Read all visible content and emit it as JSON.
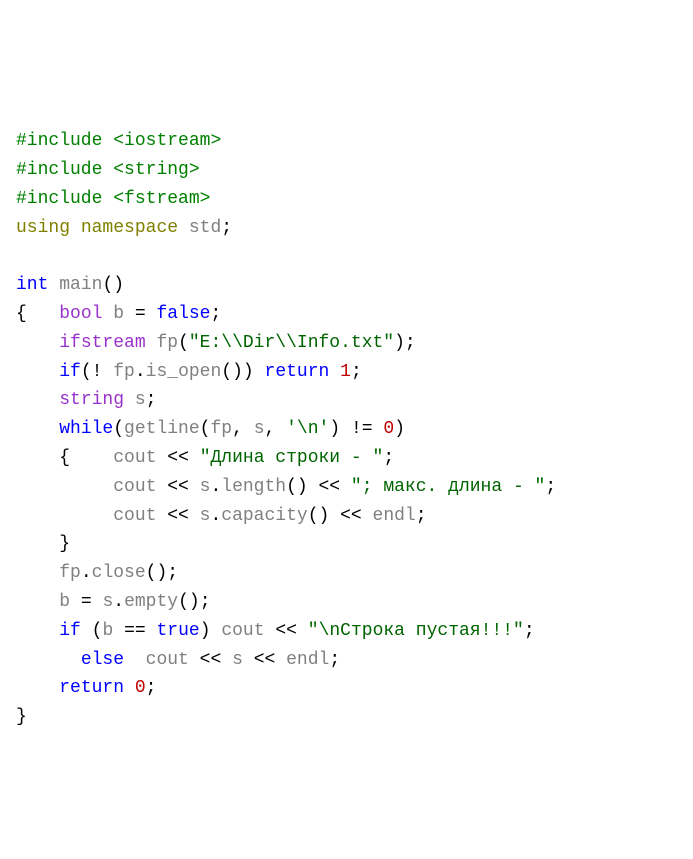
{
  "code": {
    "include1_kw": "#include",
    "include1_hdr": "<iostream>",
    "include2_kw": "#include",
    "include2_hdr": "<string>",
    "include3_kw": "#include",
    "include3_hdr": "<fstream>",
    "using_kw": "using",
    "namespace_kw": "namespace",
    "std_id": "std",
    "semi": ";",
    "int_kw": "int",
    "main_id": "main",
    "parens_empty": "()",
    "lbrace": "{",
    "rbrace": "}",
    "bool_kw": "bool",
    "b_id": "b",
    "eq": " = ",
    "false_kw": "false",
    "ifstream_kw": "ifstream",
    "fp_id": "fp",
    "lparen": "(",
    "rparen": ")",
    "path_str": "\"E:\\\\Dir\\\\Info.txt\"",
    "if_kw": "if",
    "bang": "! ",
    "dot": ".",
    "is_open_id": "is_open",
    "return_kw": "return",
    "one": "1",
    "zero": "0",
    "string_kw": "string",
    "s_id": "s",
    "while_kw": "while",
    "getline_id": "getline",
    "comma_sp": ", ",
    "nl_char": "'\\n'",
    "ne": " != ",
    "cout_id": "cout",
    "ltlt": " << ",
    "dlina_str": "\"Длина строки - \"",
    "length_id": "length",
    "maks_str": "\"; макс. длина - \"",
    "capacity_id": "capacity",
    "endl_id": "endl",
    "close_id": "close",
    "empty_id": "empty",
    "eqeq": " == ",
    "true_kw": "true",
    "nstroka_str": "\"\\nСтрока пустая!!!\"",
    "else_kw": "else"
  }
}
